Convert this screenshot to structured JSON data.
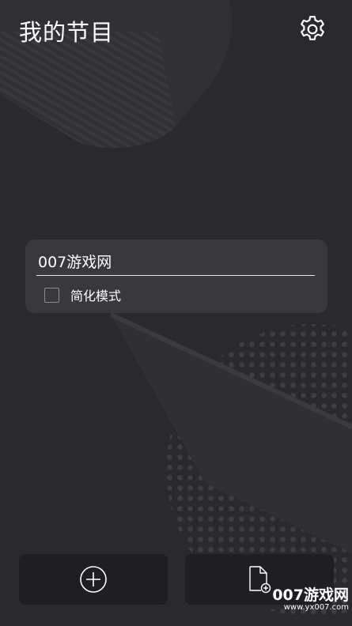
{
  "header": {
    "title": "我的节目",
    "settings_icon": "gear-icon"
  },
  "program_card": {
    "name_value": "007游戏网",
    "simple_mode": {
      "label": "简化模式",
      "checked": false
    }
  },
  "actions": {
    "add_icon": "plus-circle-icon",
    "add_file_icon": "file-add-icon"
  },
  "watermark": {
    "main": "007游戏网",
    "url": "www.yx007.com"
  },
  "colors": {
    "background": "#2a2a2e",
    "card": "#38383d",
    "bottom_button": "#1e1e23",
    "text": "#ffffff"
  }
}
